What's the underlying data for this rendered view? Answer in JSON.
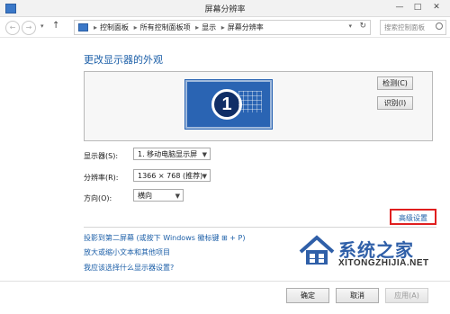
{
  "window": {
    "title": "屏幕分辨率",
    "minimize": "—",
    "maximize": "□",
    "close": "✕"
  },
  "address": {
    "crumbs": [
      "控制面板",
      "所有控制面板项",
      "显示",
      "屏幕分辨率"
    ],
    "search_placeholder": "搜索控制面板"
  },
  "main": {
    "heading": "更改显示器的外观",
    "monitor_number": "1",
    "detect_button": "检测(C)",
    "identify_button": "识别(I)",
    "display_label": "显示器(S):",
    "display_value": "1. 移动电脑显示屏",
    "resolution_label": "分辨率(R):",
    "resolution_value": "1366 × 768 (推荐)",
    "orientation_label": "方向(O):",
    "orientation_value": "横向",
    "advanced_link": "高级设置"
  },
  "links": [
    "投影到第二屏幕 (或按下 Windows 徽标键 ⊞ + P)",
    "放大或缩小文本和其他项目",
    "我应该选择什么显示器设置?"
  ],
  "buttons": {
    "ok": "确定",
    "cancel": "取消",
    "apply": "应用(A)"
  },
  "watermark": {
    "title": "系统之家",
    "url": "XITONGZHIJIA.NET"
  },
  "colors": {
    "accent": "#1c5fa8",
    "highlight_border": "#e01f1f",
    "monitor_blue": "#2a64b3"
  }
}
